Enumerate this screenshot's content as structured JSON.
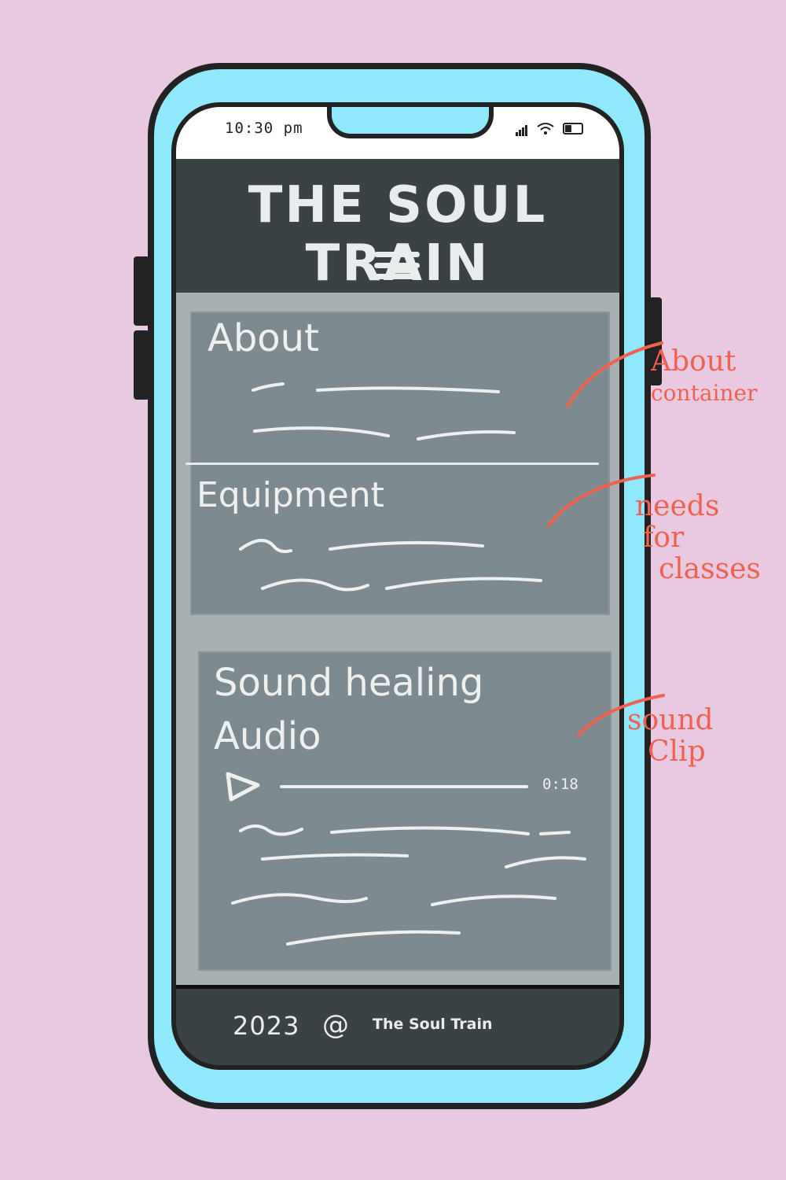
{
  "status_bar": {
    "time": "10:30 pm"
  },
  "header": {
    "title": "THE SOUL TRAIN",
    "menu_icon": "hamburger-icon"
  },
  "sections": {
    "about": {
      "title": "About"
    },
    "equipment": {
      "title": "Equipment"
    },
    "sound_healing": {
      "title_line1": "Sound healing",
      "title_line2": "Audio",
      "audio": {
        "play_icon": "play-icon",
        "time": "0:18"
      }
    }
  },
  "footer": {
    "year": "2023",
    "symbol": "@",
    "name": "The Soul Train"
  },
  "annotations": {
    "about_note_line1": "About",
    "about_note_line2": "container",
    "equipment_note_line1": "needs",
    "equipment_note_line2": "for",
    "equipment_note_line3": "classes",
    "audio_note_line1": "sound",
    "audio_note_line2": "Clip"
  },
  "colors": {
    "background": "#e8c9e1",
    "phone_body": "#8fe8fb",
    "header": "#3b4245",
    "content": "#a8b0b3",
    "card": "#7d8a8f",
    "annotation": "#f0624f"
  }
}
